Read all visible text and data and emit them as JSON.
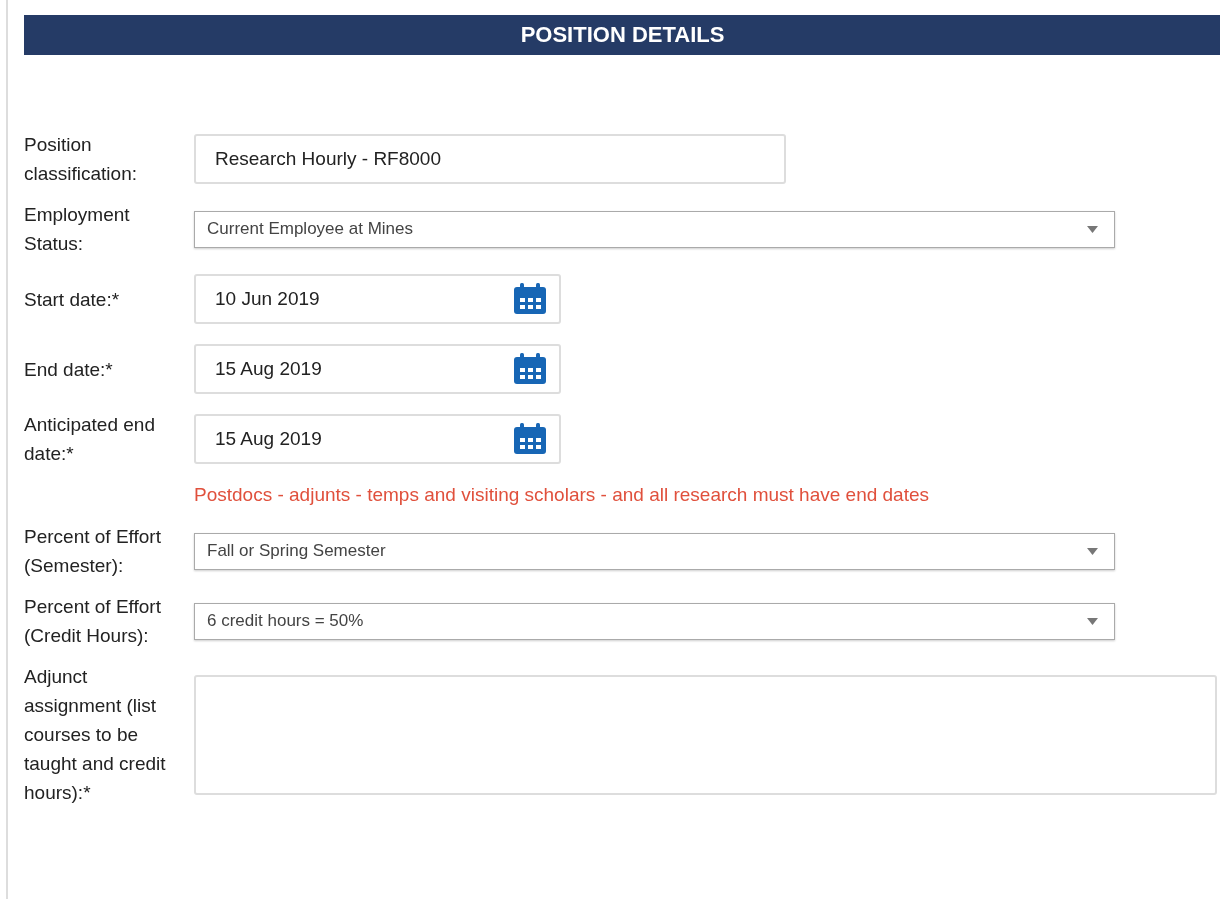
{
  "header": {
    "title": "POSITION DETAILS"
  },
  "fields": [
    {
      "kind": "text",
      "label": "Position classification:",
      "value": "Research Hourly - RF8000"
    },
    {
      "kind": "select",
      "label": "Employment Status:",
      "value": "Current Employee at Mines"
    },
    {
      "kind": "date",
      "label": "Start date:*",
      "value": "10 Jun 2019"
    },
    {
      "kind": "date",
      "label": "End date:*",
      "value": "15 Aug 2019"
    },
    {
      "kind": "date",
      "label": "Anticipated end date:*",
      "value": "15 Aug 2019"
    },
    {
      "kind": "note",
      "text": "Postdocs - adjunts - temps and visiting scholars - and all research must have end dates"
    },
    {
      "kind": "select",
      "label": "Percent of Effort (Semester):",
      "value": "Fall or Spring Semester"
    },
    {
      "kind": "select",
      "label": "Percent of Effort (Credit Hours):",
      "value": "6 credit hours = 50%"
    },
    {
      "kind": "textarea",
      "label": "Adjunct assignment (list courses to be taught and credit hours):*"
    }
  ]
}
